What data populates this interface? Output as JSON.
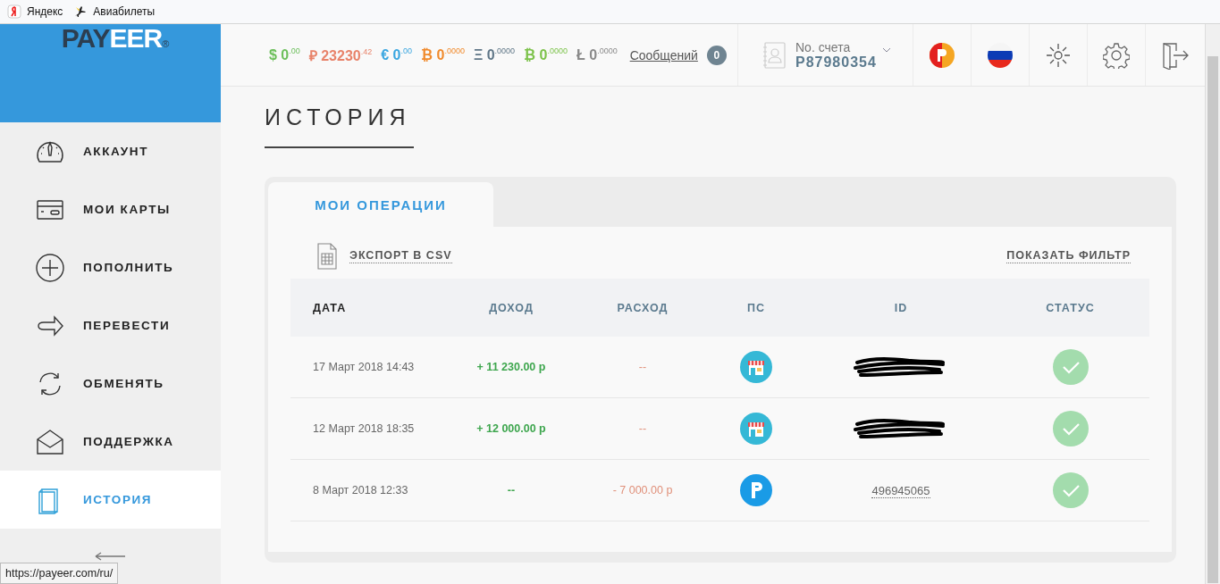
{
  "bookmarks": [
    {
      "label": "Яндекс"
    },
    {
      "label": "Авиабилеты"
    }
  ],
  "logo": {
    "dark": "PAY",
    "light": "EER",
    "mark": "®"
  },
  "sidebar": {
    "items": [
      {
        "label": "АККАУНТ",
        "selected": false
      },
      {
        "label": "МОИ КАРТЫ",
        "selected": false
      },
      {
        "label": "ПОПОЛНИТЬ",
        "selected": false
      },
      {
        "label": "ПЕРЕВЕСТИ",
        "selected": false
      },
      {
        "label": "ОБМЕНЯТЬ",
        "selected": false
      },
      {
        "label": "ПОДДЕРЖКА",
        "selected": false
      },
      {
        "label": "ИСТОРИЯ",
        "selected": true
      }
    ]
  },
  "balances": [
    {
      "symbol": "$",
      "amount": "0",
      "fraction": ".00",
      "color": "#6cbf5b"
    },
    {
      "symbol": "₽",
      "amount": "23230",
      "fraction": ".42",
      "color": "#e8836a"
    },
    {
      "symbol": "€",
      "amount": "0",
      "fraction": ".00",
      "color": "#3aa6e0"
    },
    {
      "symbol": "₿",
      "amount": "0",
      "fraction": ".0000",
      "color": "#f08a2c"
    },
    {
      "symbol": "Ξ",
      "amount": "0",
      "fraction": ".0000",
      "color": "#5f7687"
    },
    {
      "symbol": "₿",
      "amount": "0",
      "fraction": ".0000",
      "color": "#7cc24a"
    },
    {
      "symbol": "Ł",
      "amount": "0",
      "fraction": ".0000",
      "color": "#8a8a8a"
    }
  ],
  "messages": {
    "label": "Сообщений",
    "count": "0"
  },
  "account": {
    "label": "No. счета",
    "number": "P87980354"
  },
  "page_title": "ИСТОРИЯ",
  "tabs": [
    {
      "label": "МОИ ОПЕРАЦИИ",
      "selected": true
    }
  ],
  "export_link": "ЭКСПОРТ В CSV",
  "filter_link": "ПОКАЗАТЬ ФИЛЬТР",
  "table": {
    "columns": [
      "ДАТА",
      "ДОХОД",
      "РАСХОД",
      "ПС",
      "ID",
      "СТАТУС"
    ],
    "rows": [
      {
        "date": "17 Март 2018 14:43",
        "income": "+ 11 230.00 р",
        "expense": "--",
        "kind": "merchant",
        "id_redacted": true,
        "completed": true
      },
      {
        "date": "12 Март 2018 18:35",
        "income": "+ 12 000.00 р",
        "expense": "--",
        "kind": "merchant",
        "id_redacted": true,
        "completed": true
      },
      {
        "date": "8 Март 2018 12:33",
        "income": "--",
        "expense": "- 7 000.00 р",
        "kind": "payeer",
        "id": "496945065",
        "id_redacted": false,
        "completed": true
      }
    ]
  },
  "status_url": "https://payeer.com/ru/"
}
